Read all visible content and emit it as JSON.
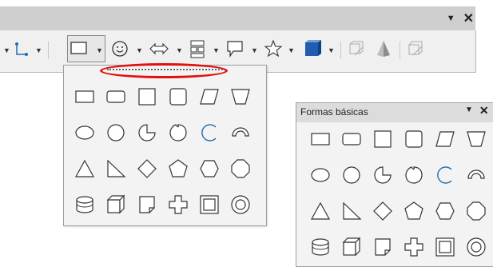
{
  "titlebar": {
    "dropdown_glyph": "▼",
    "close_glyph": "✕"
  },
  "toolbar": {
    "items": [
      {
        "icon": "connector-icon"
      },
      {
        "icon": "rectangle-icon"
      },
      {
        "icon": "smiley-icon"
      },
      {
        "icon": "double-arrow-icon"
      },
      {
        "icon": "flowchart-icon"
      },
      {
        "icon": "callout-icon"
      },
      {
        "icon": "star-icon"
      },
      {
        "icon": "cube-3d-icon"
      },
      {
        "icon": "extrusion-icon"
      },
      {
        "icon": "pyramid-icon"
      },
      {
        "icon": "extrusion-depth-icon"
      }
    ],
    "colors": {
      "connector": "#1f6fb4",
      "cube": "#1f5db0"
    }
  },
  "shapes": [
    "rectangle",
    "rounded-rectangle",
    "square",
    "rounded-square",
    "parallelogram",
    "trapezoid",
    "ellipse",
    "circle",
    "circle-pie",
    "block-arc",
    "arc",
    "circle-segment",
    "isosceles-triangle",
    "right-triangle",
    "diamond",
    "pentagon",
    "hexagon",
    "octagon",
    "cylinder",
    "cube",
    "folded-corner",
    "cross",
    "frame",
    "ring"
  ],
  "floating_panel": {
    "title": "Formas básicas",
    "dropdown_glyph": "▼",
    "close_glyph": "✕"
  }
}
